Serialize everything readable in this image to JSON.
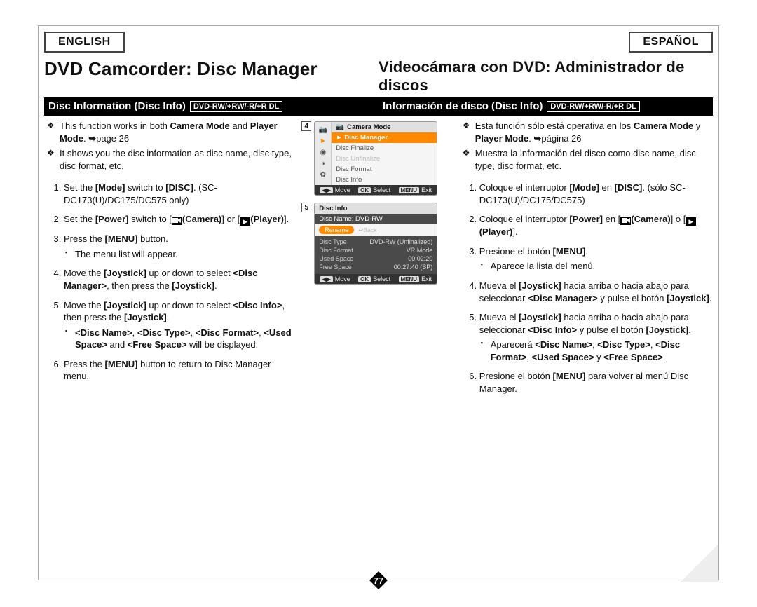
{
  "lang": {
    "left": "ENGLISH",
    "right": "ESPAÑOL"
  },
  "title": {
    "left": "DVD Camcorder: Disc Manager",
    "right": "Videocámara con DVD: Administrador de discos"
  },
  "sectionbar": {
    "left": "Disc Information (Disc Info)",
    "right": "Información de disco (Disc Info)",
    "disclabel": "DVD-RW/+RW/-R/+R DL"
  },
  "left": {
    "bullets": [
      "This function works in both <b>Camera Mode</b> and <b>Player Mode</b>. <span class='arrow'>➥</span>page 26",
      "It shows you the disc information as disc name, disc type, disc format, etc."
    ],
    "steps": [
      "Set the <b>[Mode]</b> switch to <b>[DISC]</b>. (SC-DC173(U)/DC175/DC575 only)",
      "Set the <b>[Power]</b> switch to [<span class='camicon' data-name='camera-icon'><svg viewBox='0 0 12 9'><rect x='0' y='1' width='8' height='7' fill='white'/><polygon points='8,3 12,1 12,8 8,6' fill='white'/></svg></span><b>(Camera)</b>] or [<span class='playicon' data-name='player-icon'></span><b>(Player)</b>].",
      "Press the <b>[MENU]</b> button.<ul class='sq'><li>The menu list will appear.</li></ul>",
      "Move the <b>[Joystick]</b> up or down to select <b>&lt;Disc Manager&gt;</b>, then press the <b>[Joystick]</b>.",
      "Move the <b>[Joystick]</b> up or down to select <b>&lt;Disc Info&gt;</b>, then press the <b>[Joystick]</b>.<ul class='sq'><li><b>&lt;Disc Name&gt;</b>, <b>&lt;Disc Type&gt;</b>, <b>&lt;Disc Format&gt;</b>, <b>&lt;Used Space&gt;</b> and <b>&lt;Free Space&gt;</b> will be displayed.</li></ul>",
      "Press the <b>[MENU]</b> button to return to Disc Manager menu."
    ]
  },
  "right": {
    "bullets": [
      "Esta función sólo está operativa en los <b>Camera Mode</b> y <b>Player Mode</b>. <span class='arrow'>➥</span>página 26",
      "Muestra la información del disco como disc name, disc type, disc format, etc."
    ],
    "steps": [
      "Coloque el interruptor <b>[Mode]</b> en <b>[DISC]</b>. (sólo SC-DC173(U)/DC175/DC575)",
      "Coloque el interruptor <b>[Power]</b> en [<span class='camicon' data-name='camera-icon'><svg viewBox='0 0 12 9'><rect x='0' y='1' width='8' height='7' fill='white'/><polygon points='8,3 12,1 12,8 8,6' fill='white'/></svg></span><b>(Camera)</b>] o [<span class='playicon' data-name='player-icon'></span><b>(Player)</b>].",
      "Presione el botón <b>[MENU]</b>.<ul class='sq'><li>Aparece la lista del menú.</li></ul>",
      "Mueva el <b>[Joystick]</b> hacia arriba o hacia abajo para seleccionar <b>&lt;Disc Manager&gt;</b> y pulse el botón <b>[Joystick]</b>.",
      "Mueva el <b>[Joystick]</b> hacia arriba o hacia abajo para seleccionar <b>&lt;Disc Info&gt;</b> y pulse el botón <b>[Joystick]</b>.<ul class='sq'><li>Aparecerá <b>&lt;Disc Name&gt;</b>, <b>&lt;Disc Type&gt;</b>, <b>&lt;Disc Format&gt;</b>, <b>&lt;Used Space&gt;</b> y <b>&lt;Free Space&gt;</b>.</li></ul>",
      "Presione el botón <b>[MENU]</b> para volver al menú Disc Manager."
    ]
  },
  "panel4": {
    "num": "4",
    "title": "Camera Mode",
    "items": [
      {
        "label": "Disc Manager",
        "class": "hl"
      },
      {
        "label": "Disc Finalize",
        "class": ""
      },
      {
        "label": "Disc Unfinalize",
        "class": "dim"
      },
      {
        "label": "Disc Format",
        "class": ""
      },
      {
        "label": "Disc Info",
        "class": ""
      }
    ],
    "footer": {
      "move": "Move",
      "select": "Select",
      "exit": "Exit",
      "ok": "OK",
      "menu": "MENU"
    }
  },
  "panel5": {
    "num": "5",
    "header": "Disc Info",
    "sub": "Disc Name: DVD-RW",
    "rename": "Rename",
    "back": "↩Back",
    "rows": [
      [
        "Disc Type",
        "DVD-RW (Unfinalized)"
      ],
      [
        "Disc Format",
        "VR Mode"
      ],
      [
        "Used Space",
        "00:02:20"
      ],
      [
        "Free Space",
        "00:27:40 (SP)"
      ]
    ],
    "footer": {
      "move": "Move",
      "select": "Select",
      "exit": "Exit",
      "ok": "OK",
      "menu": "MENU"
    }
  },
  "pagenum": "77"
}
